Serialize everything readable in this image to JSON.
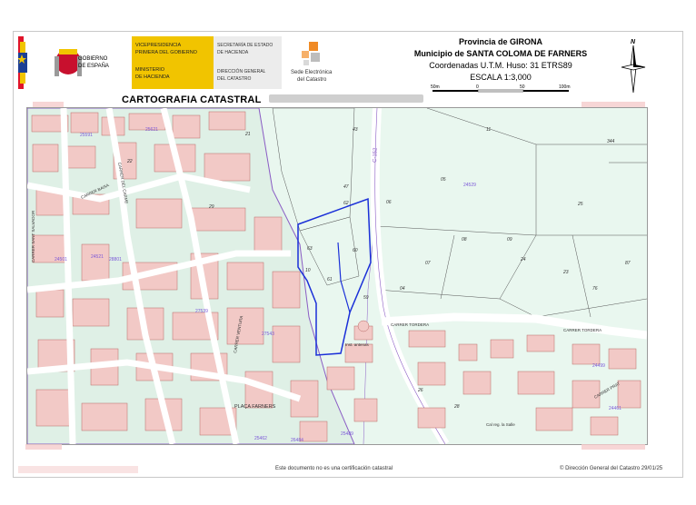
{
  "header": {
    "gov_line1": "GOBIERNO",
    "gov_line2": "DE ESPAÑA",
    "vice_line1": "VICEPRESIDENCIA",
    "vice_line2": "PRIMERA DEL GOBIERNO",
    "min_line1": "MINISTERIO",
    "min_line2": "DE HACIENDA",
    "sec_line1": "SECRETARÍA DE ESTADO",
    "sec_line2": "DE HACIENDA",
    "dir_line1": "DIRECCIÓN GENERAL",
    "dir_line2": "DEL CATASTRO",
    "sede_line1": "Sede Electrónica",
    "sede_line2": "del Catastro",
    "section_title": "CARTOGRAFIA CATASTRAL",
    "province": "Provincia de GIRONA",
    "municipality": "Municipio de SANTA COLOMA DE FARNERS",
    "coords": "Coordenadas U.T.M. Huso: 31 ETRS89",
    "scale": "ESCALA 1:3,000",
    "scale_ticks": [
      "50m",
      "0",
      "50",
      "100m"
    ],
    "north_label": "N"
  },
  "map": {
    "parcel_numbers": [
      "21",
      "43",
      "47",
      "62",
      "06",
      "05",
      "11",
      "344",
      "25",
      "09",
      "08",
      "63",
      "60",
      "61",
      "59",
      "07",
      "24",
      "23",
      "76",
      "87",
      "10",
      "04",
      "26",
      "28",
      "22",
      "29"
    ],
    "block_codes": [
      "24529",
      "25591",
      "24521",
      "27539",
      "25621",
      "27543",
      "28801",
      "24501",
      "24499",
      "25462",
      "24461",
      "25489",
      "26484"
    ],
    "street_labels": [
      "CARRER TORDERA",
      "CARRER TORDERA",
      "PLAÇA FARNERS",
      "CARRER VENTURA",
      "CARRER BAIXA",
      "C-152",
      "CARRER SANT SALVADOR",
      "CARRER DEL CARME",
      "CARRER PRAT",
      "Cal reg. la Salle"
    ],
    "facility_label": "Inst. antenas"
  },
  "footer": {
    "disclaimer": "Este documento no es una certificación catastral",
    "copyright": "© Dirección General del Catastro 29/01/25"
  },
  "colors": {
    "parcel_fill": "#e9f7ef",
    "building_fill": "#f2c9c6",
    "building_stroke": "#b86a66",
    "block_stroke": "#8a5cc4",
    "street_fill": "#ffffff",
    "highlight": "#1a2fd8",
    "label_blue": "#7b57d8"
  }
}
